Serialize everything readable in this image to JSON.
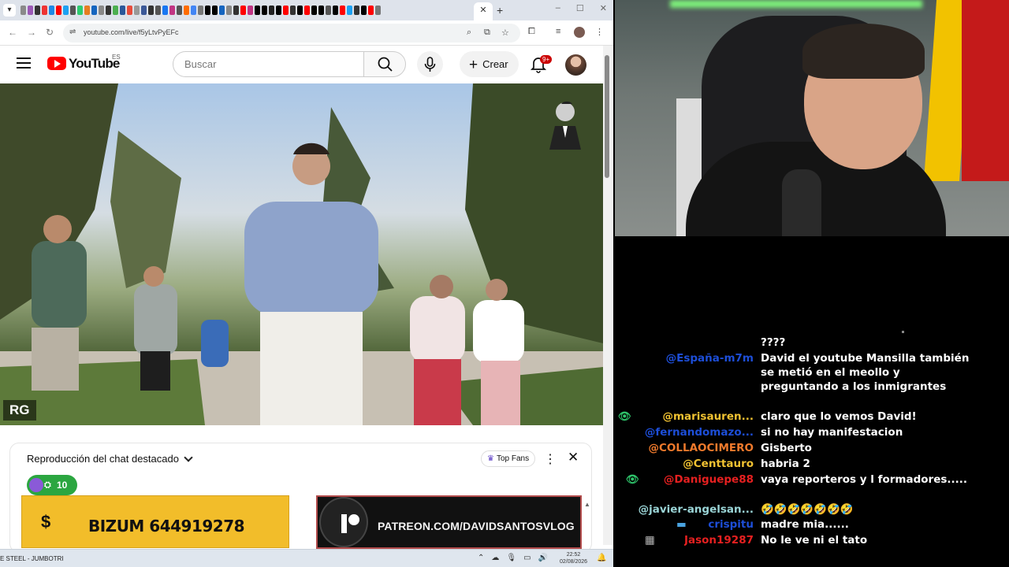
{
  "browser": {
    "tab_menu_glyph": "▾",
    "active_tab_close": "✕",
    "new_tab": "+",
    "window_controls": [
      "–",
      "☐",
      "✕"
    ],
    "favicon_colors": [
      "#8a8a8a",
      "#9b59b6",
      "#333333",
      "#e33",
      "#1e88e5",
      "#ff0000",
      "#1da1f2",
      "#555",
      "#2ecc71",
      "#e67e22",
      "#1565c0",
      "#888",
      "#333",
      "#4caf50",
      "#2b579a",
      "#e74c3c",
      "#999",
      "#3b5998",
      "#333",
      "#555",
      "#1877f2",
      "#c13584",
      "#555",
      "#ff6d00",
      "#4285f4",
      "#777",
      "#000",
      "#000",
      "#1565c0",
      "#888",
      "#333",
      "#ff0000",
      "#c13584",
      "#000",
      "#000",
      "#222",
      "#000",
      "#ff0000",
      "#333",
      "#000",
      "#ff0000",
      "#000",
      "#000",
      "#555",
      "#000",
      "#ff0000",
      "#1da1f2",
      "#333",
      "#000",
      "#ff0000",
      "#777"
    ],
    "back": "←",
    "forward": "→",
    "reload": "↻",
    "site_info": "⇌",
    "url": "youtube.com/live/f5yLtvPyEFc"
  },
  "youtube": {
    "logo_text": "YouTube",
    "country": "ES",
    "search_placeholder": "Buscar",
    "create_plus": "+",
    "create_label": "Crear",
    "notifications_badge": "9+"
  },
  "video": {
    "corner_label": "RG"
  },
  "chat_panel": {
    "title": "Reproducción del chat destacado",
    "filter_icon": "♛",
    "filter_label": "Top Fans",
    "more": "⋮",
    "close": "✕",
    "viewer_icon": "⛭",
    "viewer_count": "10",
    "scroll_arrow": "▲"
  },
  "banners": {
    "bizum_symbol": "$",
    "bizum_text": "BIZUM 644919278",
    "patreon_text": "PATREON.COM/DAVIDSANTOSVLOG"
  },
  "taskbar": {
    "left_text": "E STEEL - JUMBOTRI",
    "tray_icons": [
      "⌃",
      "☁",
      "🎙",
      "▭",
      "🔊"
    ],
    "time": "22:52",
    "date": "02/08/2026",
    "notify": "🔔"
  },
  "live_chat": {
    "messages": [
      {
        "prefix": "",
        "prefix_color": "#fff",
        "name": "",
        "name_color": "#fff",
        "text": "????"
      },
      {
        "prefix": "",
        "prefix_color": "#fff",
        "name": "@España-m7m",
        "name_color": "#1d4ed8",
        "text": "David el youtube Mansilla también se metió en el meollo y preguntando a los inmigrantes"
      },
      {
        "prefix": "👁",
        "prefix_color": "#2ec36a",
        "name": "@marisauren...",
        "name_color": "#f1c232",
        "text": "claro que lo vemos David!"
      },
      {
        "prefix": "",
        "prefix_color": "#fff",
        "name": "@fernandomazo...",
        "name_color": "#1d4ed8",
        "text": "si no hay manifestacion"
      },
      {
        "prefix": "",
        "prefix_color": "#fff",
        "name": "@COLLAOCIMERO",
        "name_color": "#f07a2c",
        "text": "Gisberto"
      },
      {
        "prefix": "",
        "prefix_color": "#fff",
        "name": "@Centtauro",
        "name_color": "#f1c232",
        "text": "habria 2"
      },
      {
        "prefix": "👁",
        "prefix_color": "#2ec36a",
        "name": "@Daniguepe88",
        "name_color": "#e52020",
        "text": "vaya reporteros y l formadores....."
      },
      {
        "prefix": "",
        "prefix_color": "#fff",
        "name": "@javier-angelsan...",
        "name_color": "#9ad4d6",
        "text": "🤣🤣🤣🤣🤣🤣🤣"
      },
      {
        "prefix": "▬",
        "prefix_color": "#4aa3df",
        "name": "crispitu",
        "name_color": "#1d4ed8",
        "text": "madre mia......"
      },
      {
        "prefix": "▦",
        "prefix_color": "#bbbbbb",
        "name": "Jason19287",
        "name_color": "#e52020",
        "text": "No le ve ni el tato"
      }
    ]
  }
}
